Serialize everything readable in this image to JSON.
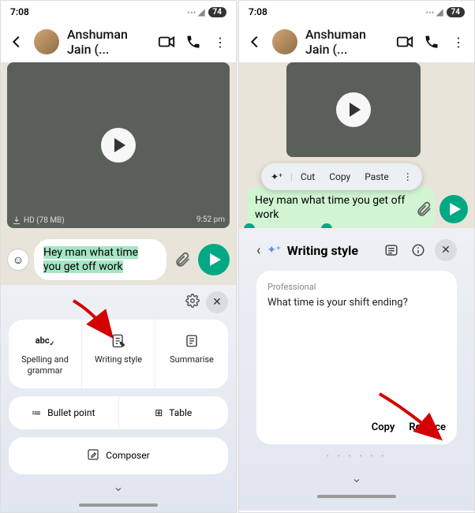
{
  "statusbar": {
    "time": "7:08",
    "icons_left": "⬚ ↥ ↥ •",
    "battery": "74"
  },
  "contact": {
    "name": "Anshuman Jain (..."
  },
  "video": {
    "quality": "HD (78 MB)",
    "time": "9:52 pm"
  },
  "message": {
    "text": "Hey man what time you get off work"
  },
  "ai_panel": {
    "options": [
      {
        "icon": "abc✓",
        "label": "Spelling and grammar"
      },
      {
        "icon": "🖉",
        "label": "Writing style"
      },
      {
        "icon": "⧉",
        "label": "Summarise"
      }
    ],
    "row2": [
      {
        "icon": "≔",
        "label": "Bullet point"
      },
      {
        "icon": "⊞",
        "label": "Table"
      }
    ],
    "composer": {
      "icon": "✎",
      "label": "Composer"
    }
  },
  "context_menu": {
    "items": [
      "Cut",
      "Copy",
      "Paste"
    ]
  },
  "writing_style": {
    "title": "Writing style",
    "style_label": "Professional",
    "result": "What time is your shift ending?",
    "actions": {
      "copy": "Copy",
      "replace": "Replace"
    }
  }
}
